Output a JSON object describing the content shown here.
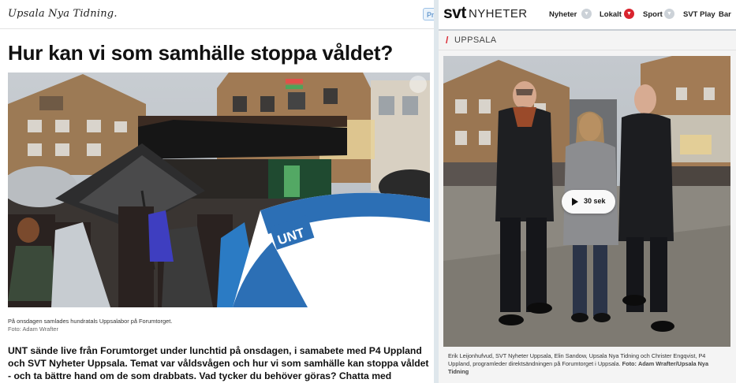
{
  "unt": {
    "logo": "Upsala Nya Tidning.",
    "pr_badge": "Pr",
    "headline": "Hur kan vi som samhälle stoppa våldet?",
    "photo_caption": "På onsdagen samlades hundratals Uppsalabor på Forumtorget.",
    "photo_credit": "Foto: Adam Wrafter",
    "umbrella_logo": "UNT",
    "ingress": "UNT sände live från Forumtorget under lunchtid på onsdagen, i samabete med P4 Uppland och SVT Nyheter Uppsala. Temat var våldsvågen och hur vi som samhälle kan stoppa våldet - och ta bättre hand om de som drabbats. Vad tycker du behöver göras? Chatta med"
  },
  "svt": {
    "logo": "svt",
    "logo_sub": "NYHETER",
    "nav": [
      {
        "label": "Nyheter",
        "chevron": "chevron-down-icon"
      },
      {
        "label": "Lokalt",
        "chevron": "chevron-down-icon",
        "active": true
      },
      {
        "label": "Sport",
        "chevron": "chevron-down-icon"
      },
      {
        "label": "SVT Play"
      },
      {
        "label": "Bar"
      }
    ],
    "section": "UPPSALA",
    "video_duration": "30 sek",
    "caption": "Erik Leijonhufvud, SVT Nyheter Uppsala, Elin Sandow, Upsala Nya Tidning och Christer Engqvist, P4 Uppland, programleder direktsändningen på Forumtorget i Uppsala.",
    "caption_foto_label": "Foto:",
    "caption_credit": "Adam Wrafter/Upsala Nya Tidning"
  },
  "colors": {
    "svt_red": "#d9242e",
    "unt_blue": "#2c6fb5",
    "page_bg": "#dfe7ec"
  }
}
